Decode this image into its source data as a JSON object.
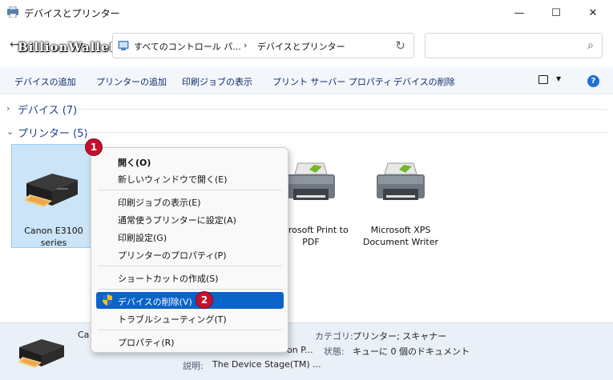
{
  "window": {
    "title": "デバイスとプリンター",
    "minimize": "—",
    "maximize": "☐",
    "close": "✕"
  },
  "watermark": "BillionWallet.com",
  "address": {
    "crumb1": "すべてのコントロール パ...",
    "separator": "›",
    "crumb2": "デバイスとプリンター",
    "refresh": "↻"
  },
  "search": {
    "icon": "⌕",
    "placeholder": ""
  },
  "commands": {
    "add_device": "デバイスの追加",
    "add_printer": "プリンターの追加",
    "show_print_jobs": "印刷ジョブの表示",
    "print_server_props": "プリント サーバー プロパティ",
    "remove_device": "デバイスの削除",
    "help": "?"
  },
  "groups": {
    "devices": {
      "chevron": "›",
      "title": "デバイス (7)"
    },
    "printers": {
      "chevron": "⌄",
      "title": "プリンター (5)"
    }
  },
  "printers": {
    "canon": "Canon E3100 series",
    "ms_pdf": "Microsoft Print to PDF",
    "ms_xps": "Microsoft XPS Document Writer"
  },
  "details": {
    "name_partial": "Ca",
    "model_partial": "on P...",
    "category_label": "カテゴリ:",
    "category_value": "プリンター; スキャナー",
    "status_label": "状態:",
    "status_value": "キューに 0 個のドキュメント",
    "description_label": "説明:",
    "description_value": "The Device Stage(TM) ..."
  },
  "context_menu": {
    "open": "開く(O)",
    "open_new_window": "新しいウィンドウで開く(E)",
    "see_print_jobs": "印刷ジョブの表示(E)",
    "set_default": "通常使うプリンターに設定(A)",
    "print_settings": "印刷設定(G)",
    "printer_props": "プリンターのプロパティ(P)",
    "create_shortcut": "ショートカットの作成(S)",
    "remove_device": "デバイスの削除(V)",
    "troubleshoot": "トラブルシューティング(T)",
    "properties": "プロパティ(R)"
  },
  "badges": {
    "one": "1",
    "two": "2"
  },
  "colors": {
    "accent": "#0a63c9",
    "selection": "#cce4f7",
    "command_text": "#0e2a6b",
    "group_title": "#1e3e8a",
    "badge": "#c8102e"
  },
  "icons": {
    "app": "devices-printers-icon",
    "back": "back-arrow-icon",
    "refresh": "refresh-icon",
    "search": "search-icon",
    "view": "view-layout-icon",
    "help": "help-icon",
    "shield": "uac-shield-icon",
    "printer": "printer-icon"
  }
}
